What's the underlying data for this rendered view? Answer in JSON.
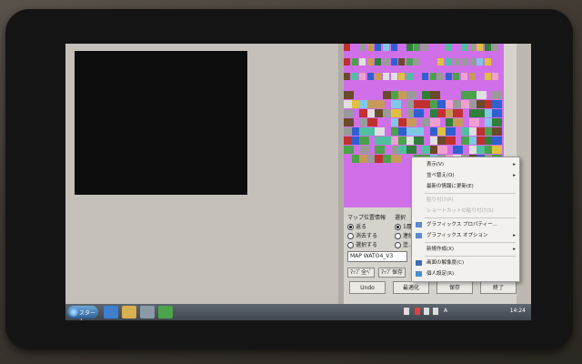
{
  "map_panel": {
    "position_header": "マップ位置情報",
    "select_header": "選択",
    "radio_left": [
      "返る",
      "消去する",
      "選択する"
    ],
    "radio_right": [
      "1層",
      "連続",
      "塗..."
    ],
    "file_name": "MAP WATO4_V3",
    "btn_map_all": "ﾏｯﾌﾟ全ﾍﾟ",
    "btn_map_save": "ﾏｯﾌﾟ保存",
    "btn_undo": "Undo",
    "btn_optimize": "最適化",
    "btn_save": "保存",
    "btn_exit": "終了"
  },
  "context_menu": {
    "items": [
      {
        "label": "表示(V)",
        "enabled": true,
        "submenu": true
      },
      {
        "label": "並べ替え(O)",
        "enabled": true,
        "submenu": true
      },
      {
        "label": "最新の情報に更新(E)",
        "enabled": true,
        "submenu": false
      },
      {
        "label": "貼り付け(P)",
        "enabled": false,
        "submenu": false
      },
      {
        "label": "ショートカットの貼り付け(S)",
        "enabled": false,
        "submenu": false
      },
      {
        "label": "グラフィックス プロパティー...",
        "enabled": true,
        "submenu": false,
        "icon": "graphics-icon"
      },
      {
        "label": "グラフィックス オプション",
        "enabled": true,
        "submenu": true,
        "icon": "graphics-icon"
      },
      {
        "label": "新規作成(X)",
        "enabled": true,
        "submenu": true
      },
      {
        "label": "画面の解像度(C)",
        "enabled": true,
        "submenu": false,
        "icon": "display-icon"
      },
      {
        "label": "個人設定(R)",
        "enabled": true,
        "submenu": false,
        "icon": "personalize-icon"
      }
    ]
  },
  "taskbar": {
    "start_label": "スタート",
    "clock": "14:24",
    "tray_letter": "A"
  },
  "colors": {
    "palette_bg": "#d070e8",
    "taskbar": "#4a525b"
  }
}
